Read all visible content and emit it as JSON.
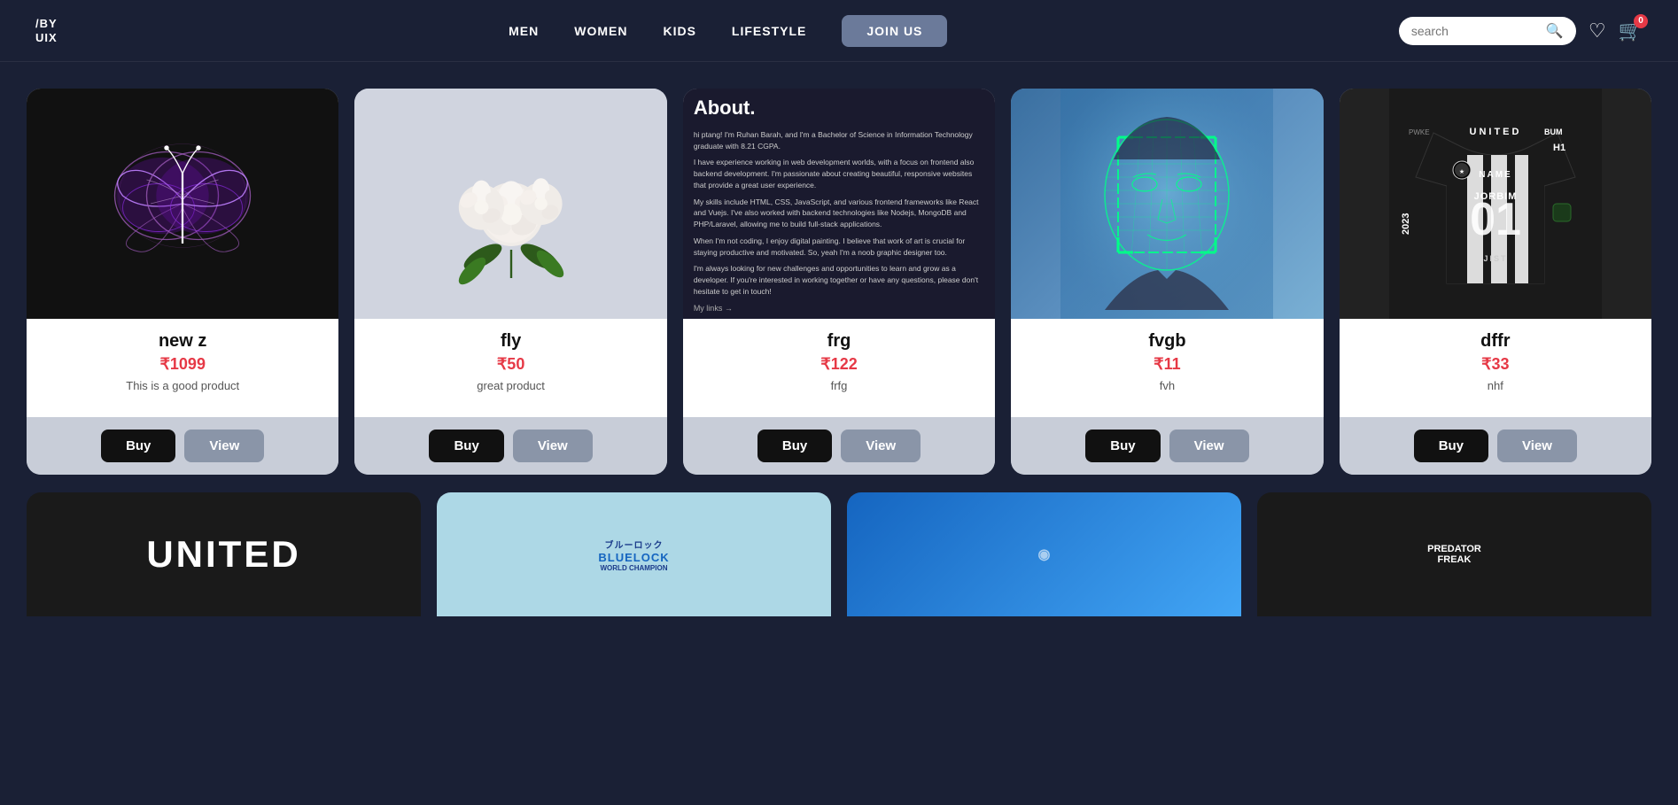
{
  "brand": {
    "logo_line1": "/BY",
    "logo_line2": "UIX"
  },
  "nav": {
    "items": [
      {
        "label": "MEN",
        "href": "#"
      },
      {
        "label": "WOMEN",
        "href": "#"
      },
      {
        "label": "KIDS",
        "href": "#"
      },
      {
        "label": "LIFESTYLE",
        "href": "#"
      },
      {
        "label": "JOIN US",
        "href": "#",
        "type": "button"
      }
    ]
  },
  "search": {
    "placeholder": "search"
  },
  "cart": {
    "badge": "0"
  },
  "products_row1": [
    {
      "id": "new-z",
      "title": "new z",
      "price": "₹1099",
      "description": "This is a good product",
      "buy_label": "Buy",
      "view_label": "View",
      "image_type": "butterfly"
    },
    {
      "id": "fly",
      "title": "fly",
      "price": "₹50",
      "description": "great product",
      "buy_label": "Buy",
      "view_label": "View",
      "image_type": "roses"
    },
    {
      "id": "frg",
      "title": "frg",
      "price": "₹122",
      "description": "frfg",
      "buy_label": "Buy",
      "view_label": "View",
      "image_type": "about"
    },
    {
      "id": "fvgb",
      "title": "fvgb",
      "price": "₹11",
      "description": "fvh",
      "buy_label": "Buy",
      "view_label": "View",
      "image_type": "face-scan"
    },
    {
      "id": "dffr",
      "title": "dffr",
      "price": "₹33",
      "description": "nhf",
      "buy_label": "Buy",
      "view_label": "View",
      "image_type": "jersey"
    }
  ],
  "about_content": {
    "heading": "About.",
    "intro": "hi ptang! I'm Ruhan Barah, and I'm a Bachelor of Science in Information Technology graduate with 8.21 CGPA.",
    "para1": "I have experience working in web development worlds, with a focus on frontend also backend development. I'm passionate about creating beautiful, responsive websites that provide a great user experience.",
    "para2": "My skills include HTML, CSS, JavaScript, and various frontend frameworks like React and Vuejs. I've also worked with backend technologies like Nodejs, MongoDB and PHP/Laravel, allowing me to build full-stack applications.",
    "para3": "When I'm not coding, I enjoy digital painting. I believe that work of art is crucial for staying productive and motivated. So, yeah I'm a noob graphic designer too.",
    "para4": "I'm always looking for new challenges and opportunities to learn and grow as a developer. If you're interested in working together or have any questions, please don't hesitate to get in touch!",
    "links_label": "My links →"
  },
  "jersey_data": {
    "team": "UNITED",
    "year": "2023",
    "name": "JORBIM",
    "number": "01",
    "tags": [
      "NAME",
      "H1",
      "JIST",
      "H1"
    ]
  },
  "products_row2": [
    {
      "id": "united",
      "type": "united"
    },
    {
      "id": "bluelock",
      "type": "bluelock"
    },
    {
      "id": "blue-img",
      "type": "blue"
    },
    {
      "id": "tshirt",
      "type": "tshirt"
    }
  ]
}
